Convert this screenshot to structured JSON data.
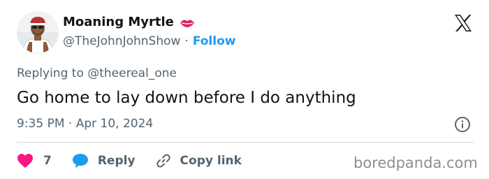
{
  "tweet": {
    "display_name": "Moaning Myrtle",
    "handle": "@TheJohnJohnShow",
    "separator": "·",
    "follow_label": "Follow",
    "reply_to": "Replying to @theereal_one",
    "text": "Go home to lay down before I do anything",
    "timestamp": "9:35 PM · Apr 10, 2024"
  },
  "actions": {
    "like_count": "7",
    "reply_label": "Reply",
    "copy_link_label": "Copy link"
  },
  "watermark": "boredpanda.com",
  "icons": {
    "avatar": "avatar",
    "name_emoji": "lips-icon",
    "brand": "x-logo-icon",
    "info": "info-icon",
    "like": "heart-icon",
    "reply": "speech-bubble-icon",
    "copy": "link-icon"
  },
  "colors": {
    "text": "#0f1419",
    "secondary": "#536471",
    "link": "#1d9bf0",
    "heart": "#f91880",
    "reply_bubble": "#1d9bf0",
    "divider": "#cfd9de"
  }
}
